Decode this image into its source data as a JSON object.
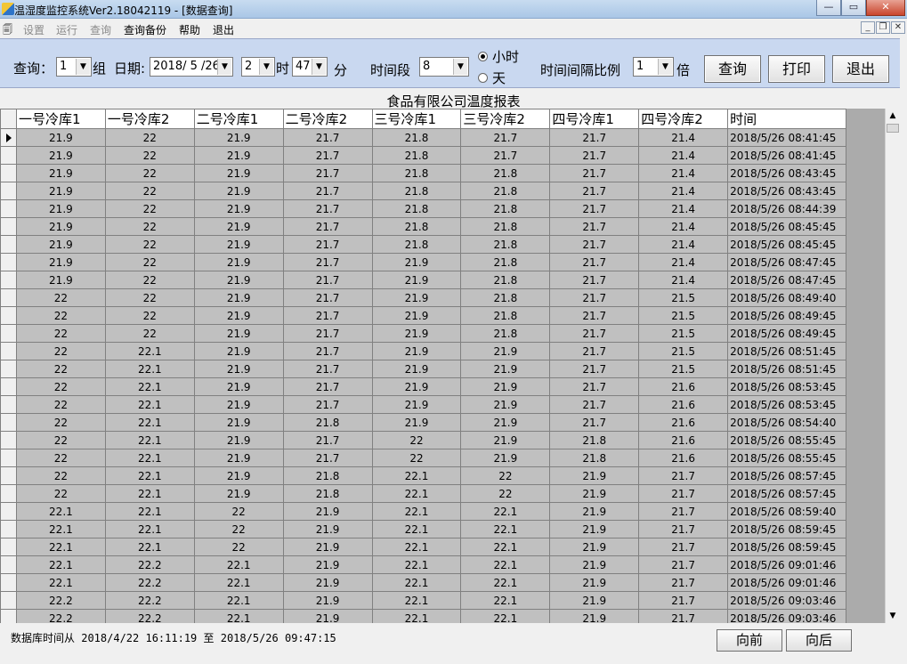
{
  "window": {
    "title": "温湿度监控系统Ver2.18042119 - [数据查询]",
    "min": "—",
    "max": "▭",
    "close": "✕"
  },
  "menu": {
    "items": [
      {
        "label": "设置",
        "enabled": false
      },
      {
        "label": "运行",
        "enabled": false
      },
      {
        "label": "查询",
        "enabled": false
      },
      {
        "label": "查询备份",
        "enabled": true
      },
      {
        "label": "帮助",
        "enabled": true
      },
      {
        "label": "退出",
        "enabled": true
      }
    ]
  },
  "query": {
    "group_label": "查询：",
    "group_value": "1",
    "group_suffix": "组",
    "date_label": "日期:",
    "date_value": "2018/ 5 /26",
    "hour_value": "2",
    "hour_suffix": "时",
    "minute_value": "47",
    "minute_suffix": "分",
    "period_label": "时间段",
    "period_value": "8",
    "unit_hour": "小时",
    "unit_day": "天",
    "unit_selected": "hour",
    "ratio_label": "时间间隔比例",
    "ratio_value": "1",
    "ratio_suffix": "倍",
    "buttons": {
      "query": "查询",
      "print": "打印",
      "exit": "退出"
    }
  },
  "report": {
    "title": "食品有限公司温度报表",
    "columns": [
      "一号冷库1",
      "一号冷库2",
      "二号冷库1",
      "二号冷库2",
      "三号冷库1",
      "三号冷库2",
      "四号冷库1",
      "四号冷库2",
      "时间"
    ],
    "rows": [
      [
        "21.9",
        "22",
        "21.9",
        "21.7",
        "21.8",
        "21.7",
        "21.7",
        "21.4",
        "2018/5/26 08:41:45"
      ],
      [
        "21.9",
        "22",
        "21.9",
        "21.7",
        "21.8",
        "21.7",
        "21.7",
        "21.4",
        "2018/5/26 08:41:45"
      ],
      [
        "21.9",
        "22",
        "21.9",
        "21.7",
        "21.8",
        "21.8",
        "21.7",
        "21.4",
        "2018/5/26 08:43:45"
      ],
      [
        "21.9",
        "22",
        "21.9",
        "21.7",
        "21.8",
        "21.8",
        "21.7",
        "21.4",
        "2018/5/26 08:43:45"
      ],
      [
        "21.9",
        "22",
        "21.9",
        "21.7",
        "21.8",
        "21.8",
        "21.7",
        "21.4",
        "2018/5/26 08:44:39"
      ],
      [
        "21.9",
        "22",
        "21.9",
        "21.7",
        "21.8",
        "21.8",
        "21.7",
        "21.4",
        "2018/5/26 08:45:45"
      ],
      [
        "21.9",
        "22",
        "21.9",
        "21.7",
        "21.8",
        "21.8",
        "21.7",
        "21.4",
        "2018/5/26 08:45:45"
      ],
      [
        "21.9",
        "22",
        "21.9",
        "21.7",
        "21.9",
        "21.8",
        "21.7",
        "21.4",
        "2018/5/26 08:47:45"
      ],
      [
        "21.9",
        "22",
        "21.9",
        "21.7",
        "21.9",
        "21.8",
        "21.7",
        "21.4",
        "2018/5/26 08:47:45"
      ],
      [
        "22",
        "22",
        "21.9",
        "21.7",
        "21.9",
        "21.8",
        "21.7",
        "21.5",
        "2018/5/26 08:49:40"
      ],
      [
        "22",
        "22",
        "21.9",
        "21.7",
        "21.9",
        "21.8",
        "21.7",
        "21.5",
        "2018/5/26 08:49:45"
      ],
      [
        "22",
        "22",
        "21.9",
        "21.7",
        "21.9",
        "21.8",
        "21.7",
        "21.5",
        "2018/5/26 08:49:45"
      ],
      [
        "22",
        "22.1",
        "21.9",
        "21.7",
        "21.9",
        "21.9",
        "21.7",
        "21.5",
        "2018/5/26 08:51:45"
      ],
      [
        "22",
        "22.1",
        "21.9",
        "21.7",
        "21.9",
        "21.9",
        "21.7",
        "21.5",
        "2018/5/26 08:51:45"
      ],
      [
        "22",
        "22.1",
        "21.9",
        "21.7",
        "21.9",
        "21.9",
        "21.7",
        "21.6",
        "2018/5/26 08:53:45"
      ],
      [
        "22",
        "22.1",
        "21.9",
        "21.7",
        "21.9",
        "21.9",
        "21.7",
        "21.6",
        "2018/5/26 08:53:45"
      ],
      [
        "22",
        "22.1",
        "21.9",
        "21.8",
        "21.9",
        "21.9",
        "21.7",
        "21.6",
        "2018/5/26 08:54:40"
      ],
      [
        "22",
        "22.1",
        "21.9",
        "21.7",
        "22",
        "21.9",
        "21.8",
        "21.6",
        "2018/5/26 08:55:45"
      ],
      [
        "22",
        "22.1",
        "21.9",
        "21.7",
        "22",
        "21.9",
        "21.8",
        "21.6",
        "2018/5/26 08:55:45"
      ],
      [
        "22",
        "22.1",
        "21.9",
        "21.8",
        "22.1",
        "22",
        "21.9",
        "21.7",
        "2018/5/26 08:57:45"
      ],
      [
        "22",
        "22.1",
        "21.9",
        "21.8",
        "22.1",
        "22",
        "21.9",
        "21.7",
        "2018/5/26 08:57:45"
      ],
      [
        "22.1",
        "22.1",
        "22",
        "21.9",
        "22.1",
        "22.1",
        "21.9",
        "21.7",
        "2018/5/26 08:59:40"
      ],
      [
        "22.1",
        "22.1",
        "22",
        "21.9",
        "22.1",
        "22.1",
        "21.9",
        "21.7",
        "2018/5/26 08:59:45"
      ],
      [
        "22.1",
        "22.1",
        "22",
        "21.9",
        "22.1",
        "22.1",
        "21.9",
        "21.7",
        "2018/5/26 08:59:45"
      ],
      [
        "22.1",
        "22.2",
        "22.1",
        "21.9",
        "22.1",
        "22.1",
        "21.9",
        "21.7",
        "2018/5/26 09:01:46"
      ],
      [
        "22.1",
        "22.2",
        "22.1",
        "21.9",
        "22.1",
        "22.1",
        "21.9",
        "21.7",
        "2018/5/26 09:01:46"
      ],
      [
        "22.2",
        "22.2",
        "22.1",
        "21.9",
        "22.1",
        "22.1",
        "21.9",
        "21.7",
        "2018/5/26 09:03:46"
      ],
      [
        "22.2",
        "22.2",
        "22.1",
        "21.9",
        "22.1",
        "22.1",
        "21.9",
        "21.7",
        "2018/5/26 09:03:46"
      ]
    ]
  },
  "status": {
    "db_range": "数据库时间从 2018/4/22 16:11:19 至 2018/5/26 09:47:15",
    "prev": "向前",
    "next": "向后"
  },
  "colors": {
    "panel": "#c9d8f0",
    "cell": "#c0c0c0",
    "grid_bg": "#ababab"
  },
  "icons": [
    "app-icon",
    "menu-doc-icon",
    "combo-arrow-icon",
    "row-pointer-icon",
    "scroll-up-icon",
    "scroll-down-icon"
  ]
}
